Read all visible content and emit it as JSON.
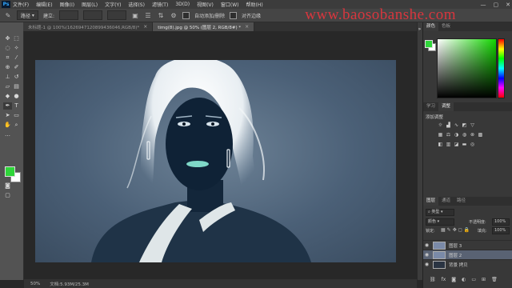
{
  "menubar": {
    "logo": "Ps",
    "items": [
      "文件(F)",
      "编辑(E)",
      "图像(I)",
      "图层(L)",
      "文字(Y)",
      "选择(S)",
      "滤镜(T)",
      "3D(D)",
      "视图(V)",
      "窗口(W)",
      "帮助(H)"
    ],
    "window_controls": [
      "—",
      "▢",
      "✕"
    ]
  },
  "options": {
    "mode_label": "路径",
    "make_label": "建立:",
    "auto_add_label": "自动添加/删除",
    "align_label": "对齐边缘"
  },
  "watermark": "www.baosobanshe.com",
  "tabs": [
    {
      "label": "未标题-1 @ 100%(1626947120899436046,RGB/8)*",
      "close": "×",
      "active": false
    },
    {
      "label": "timg(8).jpg @ 50% (图层 2, RGB/8#) *",
      "close": "×",
      "active": true
    }
  ],
  "colors": {
    "foreground": "#2fd63a",
    "background": "#ffffff",
    "accent_watermark": "#d9363e"
  },
  "statusbar": {
    "zoom": "50%",
    "doc_info": "文档:5.93M/25.3M"
  },
  "color_panel": {
    "tabs": [
      "颜色",
      "色板"
    ]
  },
  "adjust_panel": {
    "tabs": [
      "学习",
      "调整"
    ],
    "subtitle": "添加调整"
  },
  "layers_panel": {
    "tabs": [
      "图层",
      "通道",
      "路径"
    ],
    "kind_label": "类型",
    "blend_mode": "颜色",
    "opacity_label": "不透明度:",
    "opacity_value": "100%",
    "lock_label": "锁定:",
    "fill_label": "填充:",
    "fill_value": "100%",
    "layers": [
      {
        "name": "图层 3",
        "active": false,
        "locked": false
      },
      {
        "name": "图层 2",
        "active": true,
        "locked": false
      },
      {
        "name": "背景 拷贝",
        "active": false,
        "locked": false
      }
    ],
    "bottom_icons": [
      "link-icon",
      "fx-icon",
      "mask-icon",
      "adjustment-icon",
      "folder-icon",
      "new-layer-icon",
      "trash-icon"
    ]
  }
}
